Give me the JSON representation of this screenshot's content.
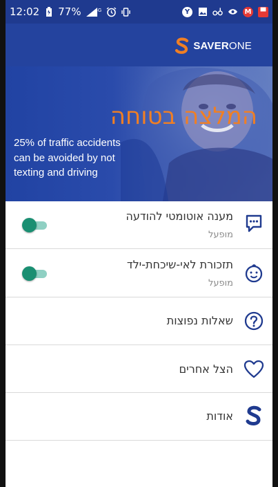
{
  "status_bar": {
    "time": "12:02",
    "battery": "77%",
    "network": "4G",
    "icons": [
      "battery-icon",
      "signal-icon",
      "alarm-icon",
      "vibrate-icon",
      "notification-y-icon",
      "image-icon",
      "link-icon",
      "app-icon",
      "m-icon",
      "red-app-icon"
    ]
  },
  "app_bar": {
    "brand_bold": "SAVER",
    "brand_light": "ONE",
    "brand_color": "#f07f24",
    "background": "#24439e"
  },
  "hero": {
    "title": "המלצה בטוחה",
    "subtitle_lines": [
      "25% of traffic accidents",
      "can be avoided by not",
      "texting and driving"
    ],
    "title_color": "#f07f24"
  },
  "menu": {
    "items": [
      {
        "title": "מענה אוטומטי להודעה",
        "status": "מופעל",
        "icon": "message-dots-icon",
        "toggle_on": true
      },
      {
        "title": "תזכורת לאי-שיכחת-ילד",
        "status": "מופעל",
        "icon": "baby-face-icon",
        "toggle_on": true
      },
      {
        "title": "שאלות נפוצות",
        "icon": "question-icon"
      },
      {
        "title": "הצל אחרים",
        "icon": "heart-icon"
      },
      {
        "title": "אודות",
        "icon": "saverone-s-icon"
      }
    ]
  },
  "colors": {
    "primary": "#24439e",
    "accent": "#f07f24",
    "toggle": "#1a8f72",
    "icon": "#1f3a8f"
  }
}
